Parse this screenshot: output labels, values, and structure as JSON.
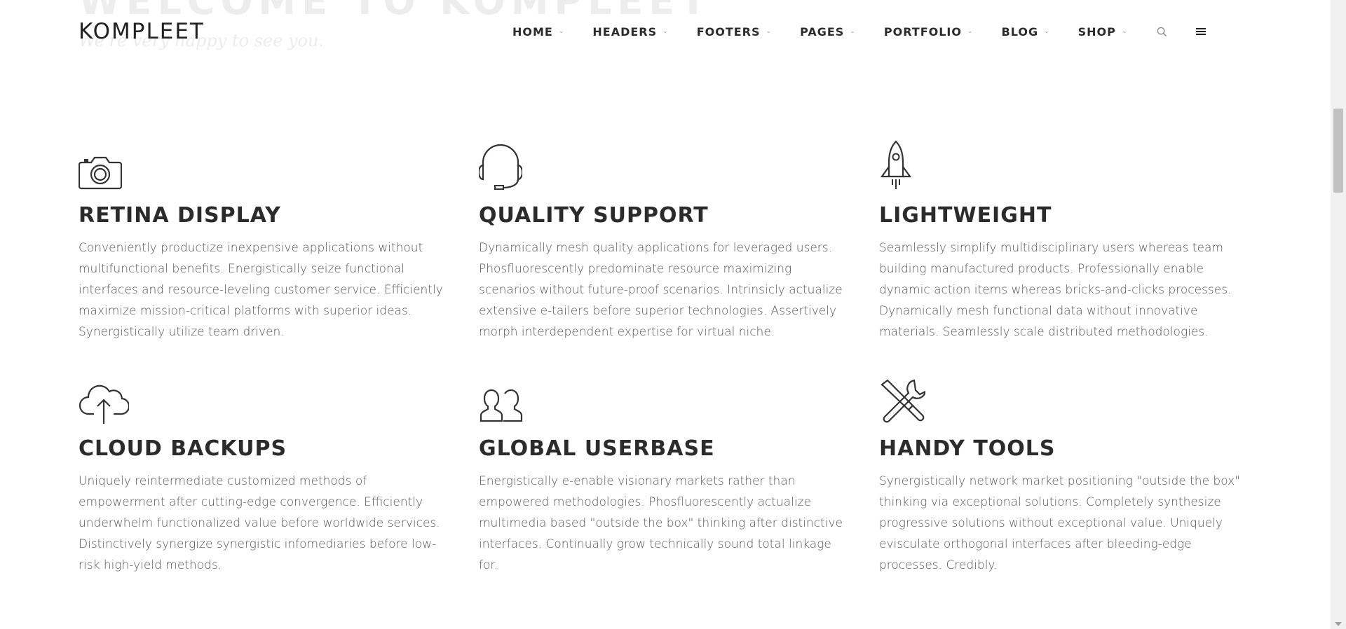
{
  "hero": {
    "title": "WELCOME TO KOMPLEET",
    "subtitle": "We're very happy to see you."
  },
  "header": {
    "logo": "KOMPLEET",
    "nav": [
      {
        "label": "HOME"
      },
      {
        "label": "HEADERS"
      },
      {
        "label": "FOOTERS"
      },
      {
        "label": "PAGES"
      },
      {
        "label": "PORTFOLIO"
      },
      {
        "label": "BLOG"
      },
      {
        "label": "SHOP"
      }
    ],
    "icons": {
      "search": "search-icon",
      "menu": "hamburger-menu-icon"
    }
  },
  "features": [
    {
      "icon": "camera-icon",
      "title": "RETINA DISPLAY",
      "text": "Conveniently productize inexpensive applications without multifunctional benefits. Energistically seize functional interfaces and resource-leveling customer service. Efficiently maximize mission-critical platforms with superior ideas. Synergistically utilize team driven."
    },
    {
      "icon": "headset-icon",
      "title": "QUALITY SUPPORT",
      "text": "Dynamically mesh quality applications for leveraged users. Phosfluorescently predominate resource maximizing scenarios without future-proof scenarios. Intrinsicly actualize extensive e-tailers before superior technologies. Assertively morph interdependent expertise for virtual niche."
    },
    {
      "icon": "rocket-icon",
      "title": "LIGHTWEIGHT",
      "text": "Seamlessly simplify multidisciplinary users whereas team building manufactured products. Professionally enable dynamic action items whereas bricks-and-clicks processes. Dynamically mesh functional data without innovative materials. Seamlessly scale distributed methodologies."
    },
    {
      "icon": "cloud-upload-icon",
      "title": "CLOUD BACKUPS",
      "text": "Uniquely reintermediate customized methods of empowerment after cutting-edge convergence. Efficiently underwhelm functionalized value before worldwide services. Distinctively synergize synergistic infomediaries before low-risk high-yield methods."
    },
    {
      "icon": "users-icon",
      "title": "GLOBAL USERBASE",
      "text": "Energistically e-enable visionary markets rather than empowered methodologies. Phosfluorescently actualize multimedia based \"outside the box\" thinking after distinctive interfaces. Continually grow technically sound total linkage for."
    },
    {
      "icon": "tools-icon",
      "title": "HANDY TOOLS",
      "text": "Synergistically network market positioning \"outside the box\" thinking via exceptional solutions. Completely synthesize progressive solutions without exceptional value. Uniquely evisculate orthogonal interfaces after bleeding-edge processes. Credibly."
    }
  ]
}
